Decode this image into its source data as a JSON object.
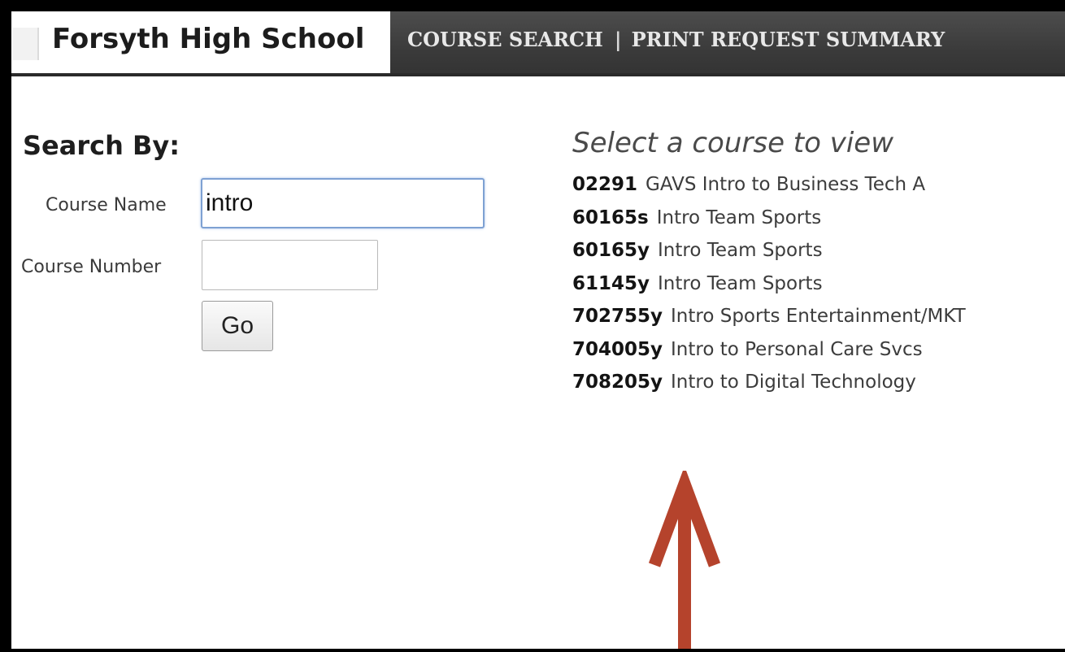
{
  "header": {
    "school_name": "Forsyth High School",
    "nav": {
      "course_search": "COURSE SEARCH",
      "separator": "|",
      "print_request_summary": "PRINT REQUEST SUMMARY"
    }
  },
  "search": {
    "title": "Search By:",
    "course_name_label": "Course Name",
    "course_name_value": "intro",
    "course_number_label": "Course Number",
    "course_number_value": "",
    "go_label": "Go"
  },
  "results": {
    "heading": "Select a course to view",
    "courses": [
      {
        "number": "02291",
        "title": "GAVS Intro to Business Tech A"
      },
      {
        "number": "60165s",
        "title": "Intro Team Sports"
      },
      {
        "number": "60165y",
        "title": "Intro Team Sports"
      },
      {
        "number": "61145y",
        "title": "Intro Team Sports"
      },
      {
        "number": "702755y",
        "title": "Intro Sports Entertainment/MKT"
      },
      {
        "number": "704005y",
        "title": "Intro to Personal Care Svcs"
      },
      {
        "number": "708205y",
        "title": "Intro to Digital Technology"
      }
    ]
  },
  "colors": {
    "frame": "#000000",
    "header_bar": "#3b3b3b",
    "input_focus_border": "#7ea1d3",
    "arrow": "#b5432c"
  },
  "icons": {
    "annotation_arrow": "up-arrow-icon"
  }
}
